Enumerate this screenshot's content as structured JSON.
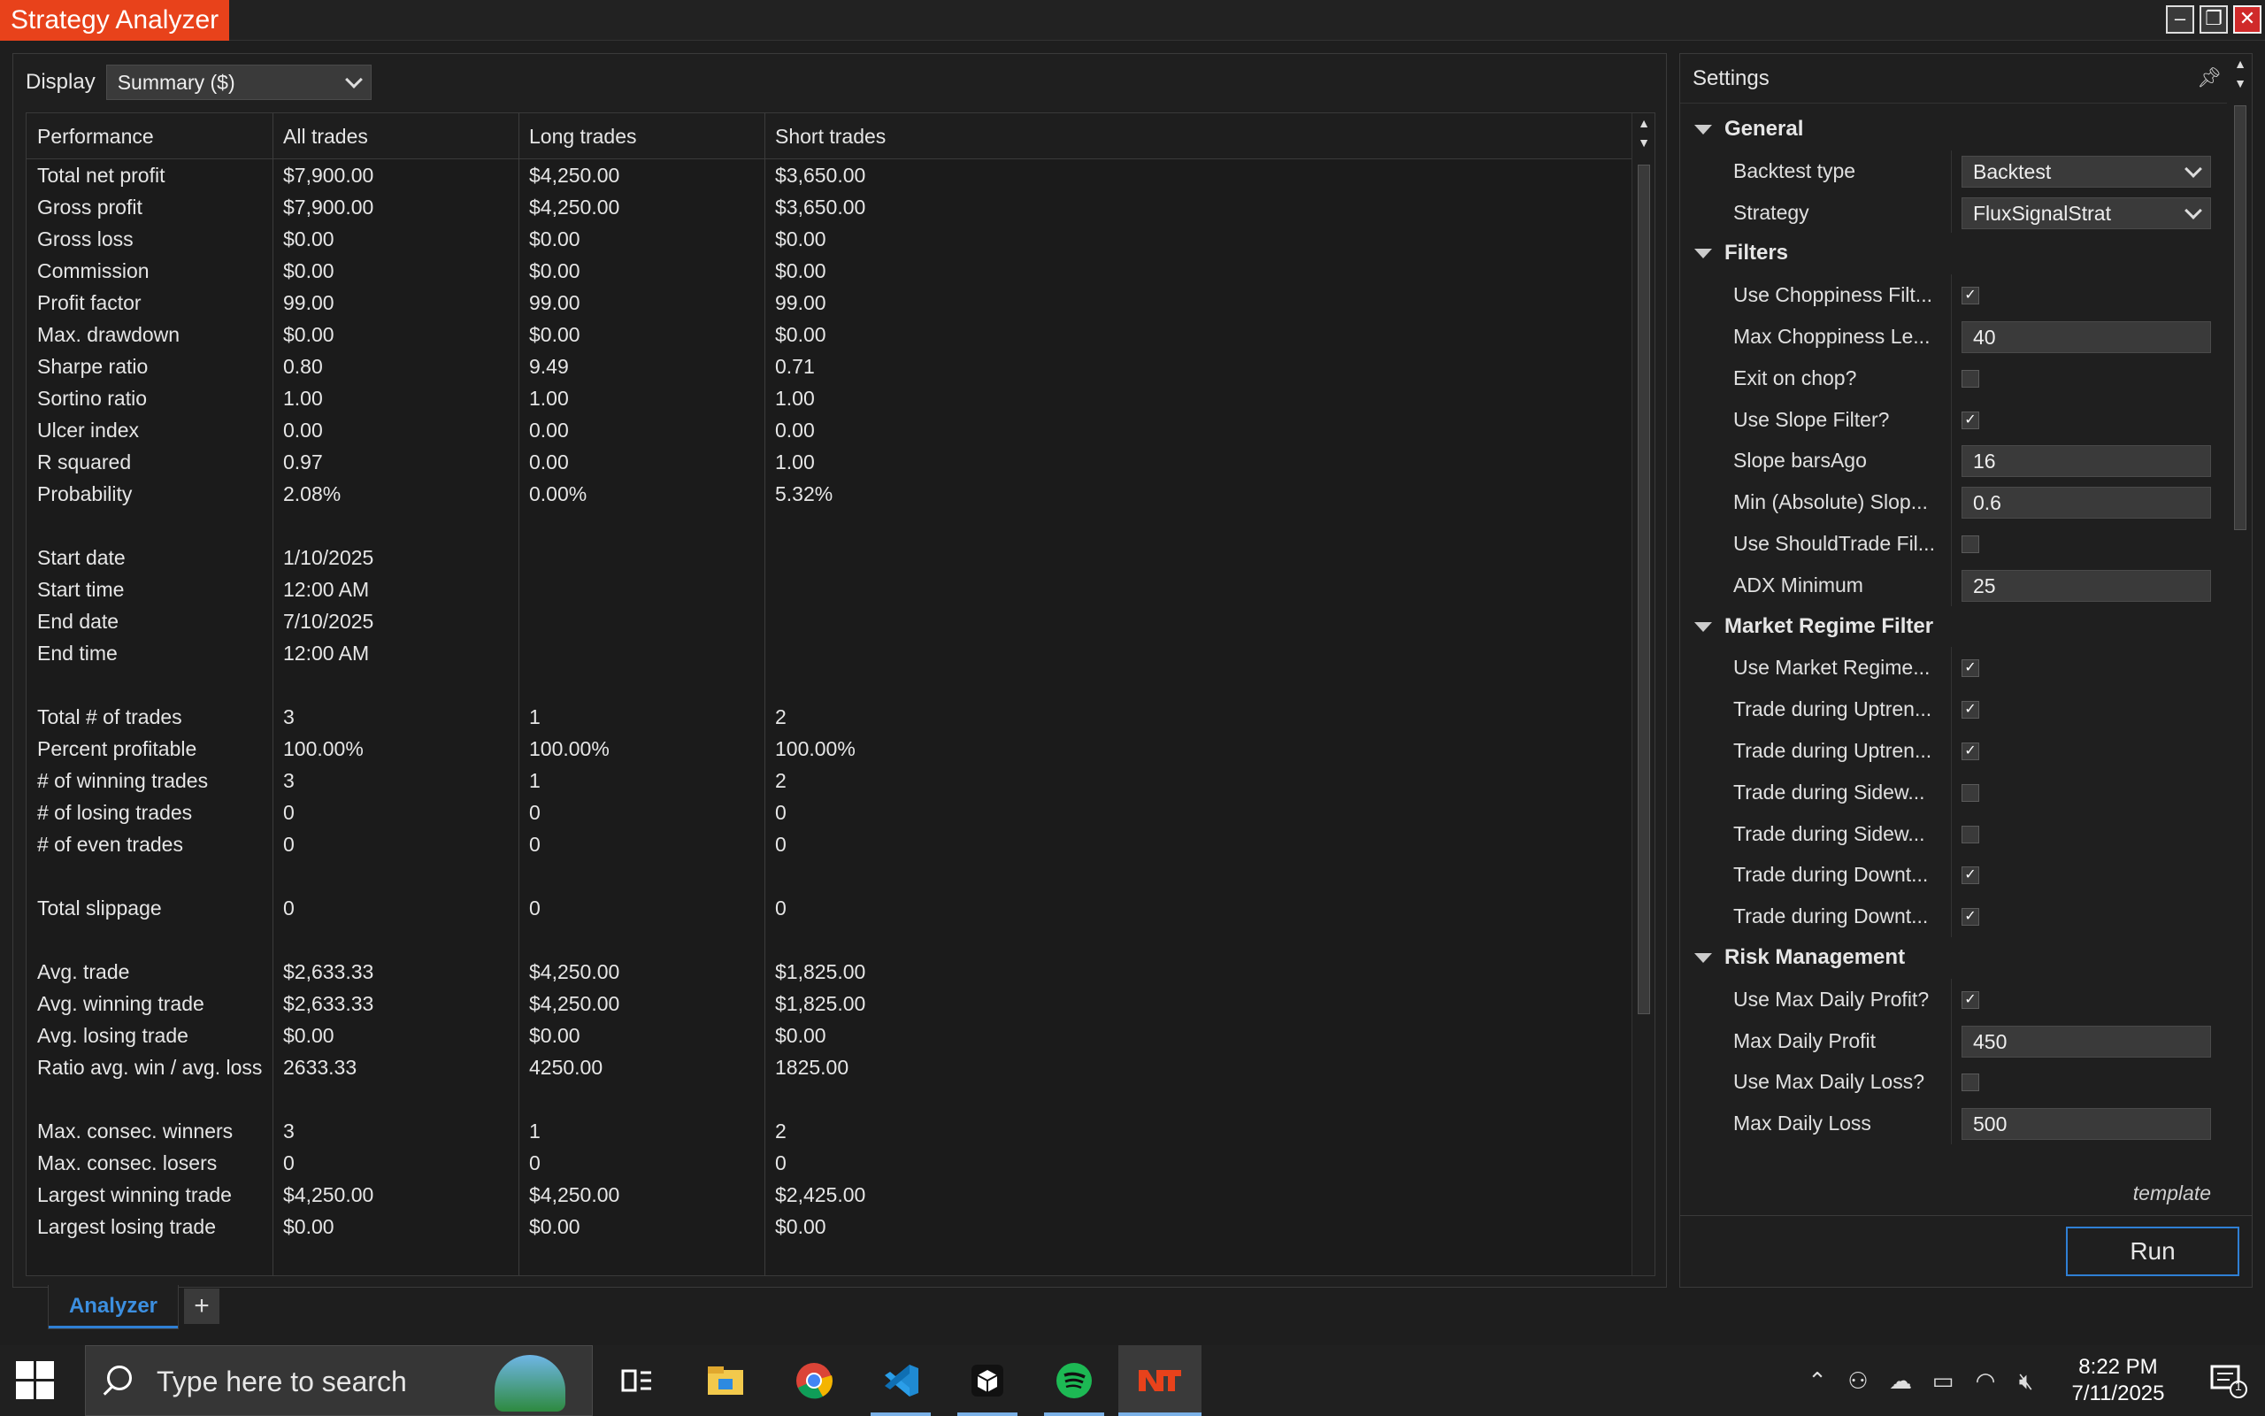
{
  "window": {
    "title": "Strategy Analyzer"
  },
  "display": {
    "label": "Display",
    "selected": "Summary ($)"
  },
  "table": {
    "columns": [
      "Performance",
      "All trades",
      "Long trades",
      "Short trades"
    ],
    "rows": [
      [
        "Total net profit",
        "$7,900.00",
        "$4,250.00",
        "$3,650.00"
      ],
      [
        "Gross profit",
        "$7,900.00",
        "$4,250.00",
        "$3,650.00"
      ],
      [
        "Gross loss",
        "$0.00",
        "$0.00",
        "$0.00"
      ],
      [
        "Commission",
        "$0.00",
        "$0.00",
        "$0.00"
      ],
      [
        "Profit factor",
        "99.00",
        "99.00",
        "99.00"
      ],
      [
        "Max. drawdown",
        "$0.00",
        "$0.00",
        "$0.00"
      ],
      [
        "Sharpe ratio",
        "0.80",
        "9.49",
        "0.71"
      ],
      [
        "Sortino ratio",
        "1.00",
        "1.00",
        "1.00"
      ],
      [
        "Ulcer index",
        "0.00",
        "0.00",
        "0.00"
      ],
      [
        "R squared",
        "0.97",
        "0.00",
        "1.00"
      ],
      [
        "Probability",
        "2.08%",
        "0.00%",
        "5.32%"
      ],
      null,
      [
        "Start date",
        "1/10/2025",
        "",
        ""
      ],
      [
        "Start time",
        "12:00 AM",
        "",
        ""
      ],
      [
        "End date",
        "7/10/2025",
        "",
        ""
      ],
      [
        "End time",
        "12:00 AM",
        "",
        ""
      ],
      null,
      [
        "Total # of trades",
        "3",
        "1",
        "2"
      ],
      [
        "Percent profitable",
        "100.00%",
        "100.00%",
        "100.00%"
      ],
      [
        "# of winning trades",
        "3",
        "1",
        "2"
      ],
      [
        "# of losing trades",
        "0",
        "0",
        "0"
      ],
      [
        "# of even trades",
        "0",
        "0",
        "0"
      ],
      null,
      [
        "Total slippage",
        "0",
        "0",
        "0"
      ],
      null,
      [
        "Avg. trade",
        "$2,633.33",
        "$4,250.00",
        "$1,825.00"
      ],
      [
        "Avg. winning trade",
        "$2,633.33",
        "$4,250.00",
        "$1,825.00"
      ],
      [
        "Avg. losing trade",
        "$0.00",
        "$0.00",
        "$0.00"
      ],
      [
        "Ratio avg. win / avg. loss",
        "2633.33",
        "4250.00",
        "1825.00"
      ],
      null,
      [
        "Max. consec. winners",
        "3",
        "1",
        "2"
      ],
      [
        "Max. consec. losers",
        "0",
        "0",
        "0"
      ],
      [
        "Largest winning trade",
        "$4,250.00",
        "$4,250.00",
        "$2,425.00"
      ],
      [
        "Largest losing trade",
        "$0.00",
        "$0.00",
        "$0.00"
      ]
    ]
  },
  "tabs": {
    "active": "Analyzer",
    "add": "+"
  },
  "settings": {
    "title": "Settings",
    "template_label": "template",
    "run_label": "Run",
    "items": [
      {
        "kind": "category",
        "label": "General"
      },
      {
        "kind": "select",
        "label": "Backtest type",
        "value": "Backtest"
      },
      {
        "kind": "select",
        "label": "Strategy",
        "value": "FluxSignalStrat"
      },
      {
        "kind": "category",
        "label": "Filters"
      },
      {
        "kind": "check",
        "label": "Use Choppiness Filt...",
        "checked": true
      },
      {
        "kind": "text",
        "label": "Max Choppiness Le...",
        "value": "40"
      },
      {
        "kind": "check",
        "label": "Exit on chop?",
        "checked": false
      },
      {
        "kind": "check",
        "label": "Use Slope Filter?",
        "checked": true
      },
      {
        "kind": "text",
        "label": "Slope barsAgo",
        "value": "16"
      },
      {
        "kind": "text",
        "label": "Min (Absolute) Slop...",
        "value": "0.6"
      },
      {
        "kind": "check",
        "label": "Use ShouldTrade Fil...",
        "checked": false
      },
      {
        "kind": "text",
        "label": "ADX Minimum",
        "value": "25"
      },
      {
        "kind": "category",
        "label": "Market Regime Filter"
      },
      {
        "kind": "check",
        "label": "Use Market Regime...",
        "checked": true
      },
      {
        "kind": "check",
        "label": "Trade during Uptren...",
        "checked": true
      },
      {
        "kind": "check",
        "label": "Trade during Uptren...",
        "checked": true
      },
      {
        "kind": "check",
        "label": "Trade during Sidew...",
        "checked": false
      },
      {
        "kind": "check",
        "label": "Trade during Sidew...",
        "checked": false
      },
      {
        "kind": "check",
        "label": "Trade during Downt...",
        "checked": true
      },
      {
        "kind": "check",
        "label": "Trade during Downt...",
        "checked": true
      },
      {
        "kind": "category",
        "label": "Risk Management"
      },
      {
        "kind": "check",
        "label": "Use Max Daily Profit?",
        "checked": true
      },
      {
        "kind": "text",
        "label": "Max Daily Profit",
        "value": "450"
      },
      {
        "kind": "check",
        "label": "Use Max Daily Loss?",
        "checked": false
      },
      {
        "kind": "text",
        "label": "Max Daily Loss",
        "value": "500"
      }
    ]
  },
  "taskbar": {
    "search_placeholder": "Type here to search",
    "time": "8:22 PM",
    "date": "7/11/2025",
    "notification_count": "1",
    "apps": [
      "task-view-icon",
      "file-explorer-icon",
      "chrome-icon",
      "vscode-icon",
      "app-cube-icon",
      "spotify-icon",
      "ninjatrader-icon"
    ]
  },
  "colors": {
    "accent_title": "#e8421b",
    "run_border": "#2f7fd4",
    "tab_text": "#3c8fe0"
  }
}
